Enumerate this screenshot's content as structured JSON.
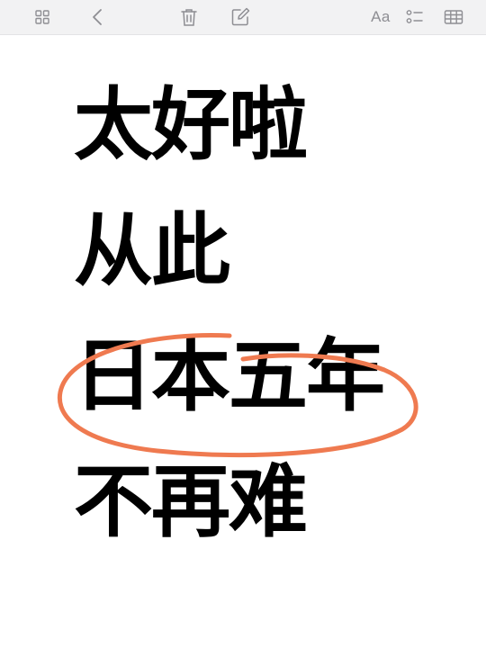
{
  "toolbar": {
    "icons": {
      "left": "grid-view-icon",
      "back": "chevron-left-icon",
      "delete": "trash-icon",
      "compose": "compose-icon",
      "format": "text-format-icon",
      "checklist": "checklist-icon",
      "table": "table-icon"
    },
    "format_label": "Aa"
  },
  "note": {
    "lines": [
      "太好啦",
      "从此",
      "日本五年",
      "不再难"
    ]
  },
  "colors": {
    "text": "#000000",
    "highlight_circle": "#ef7a50",
    "toolbar_bg": "#f2f2f3",
    "icon": "#8e8e93"
  }
}
